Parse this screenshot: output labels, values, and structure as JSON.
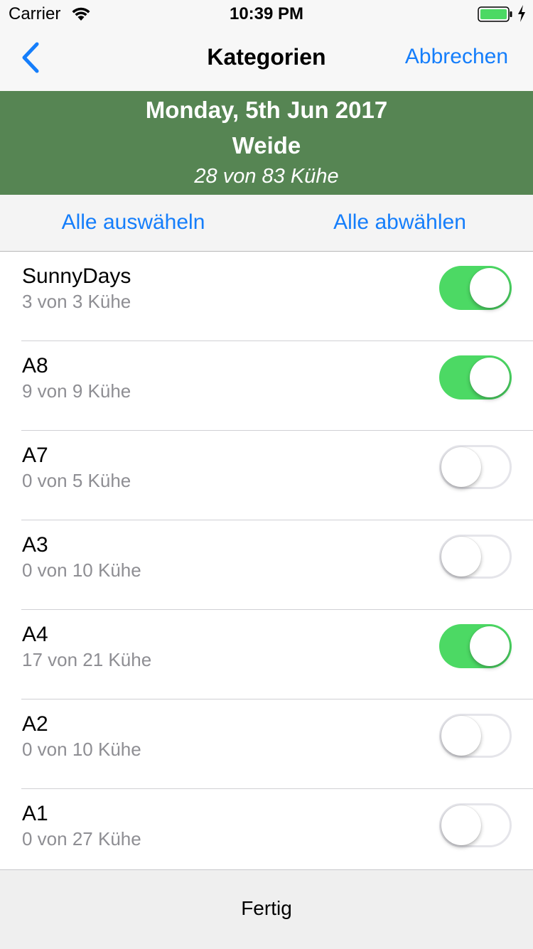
{
  "status_bar": {
    "carrier": "Carrier",
    "time": "10:39 PM",
    "wifi_icon": "wifi-icon",
    "battery_icon": "battery-full-charging-icon"
  },
  "nav": {
    "back_icon": "chevron-left-icon",
    "title": "Kategorien",
    "cancel_label": "Abbrechen"
  },
  "header": {
    "date": "Monday, 5th Jun 2017",
    "location": "Weide",
    "count": "28 von 83 Kühe",
    "background_color": "#568553"
  },
  "select_bar": {
    "select_all_label": "Alle auswäheln",
    "deselect_all_label": "Alle abwählen"
  },
  "categories": [
    {
      "name": "SunnyDays",
      "count": "3 von 3 Kühe",
      "enabled": true
    },
    {
      "name": "A8",
      "count": "9 von 9 Kühe",
      "enabled": true
    },
    {
      "name": "A7",
      "count": "0 von 5 Kühe",
      "enabled": false
    },
    {
      "name": "A3",
      "count": "0 von 10 Kühe",
      "enabled": false
    },
    {
      "name": "A4",
      "count": "17 von 21 Kühe",
      "enabled": true
    },
    {
      "name": "A2",
      "count": "0 von 10 Kühe",
      "enabled": false
    },
    {
      "name": "A1",
      "count": "0 von 27 Kühe",
      "enabled": false
    }
  ],
  "footer": {
    "done_label": "Fertig"
  },
  "colors": {
    "accent": "#157efb",
    "switch_on": "#4cd964"
  }
}
